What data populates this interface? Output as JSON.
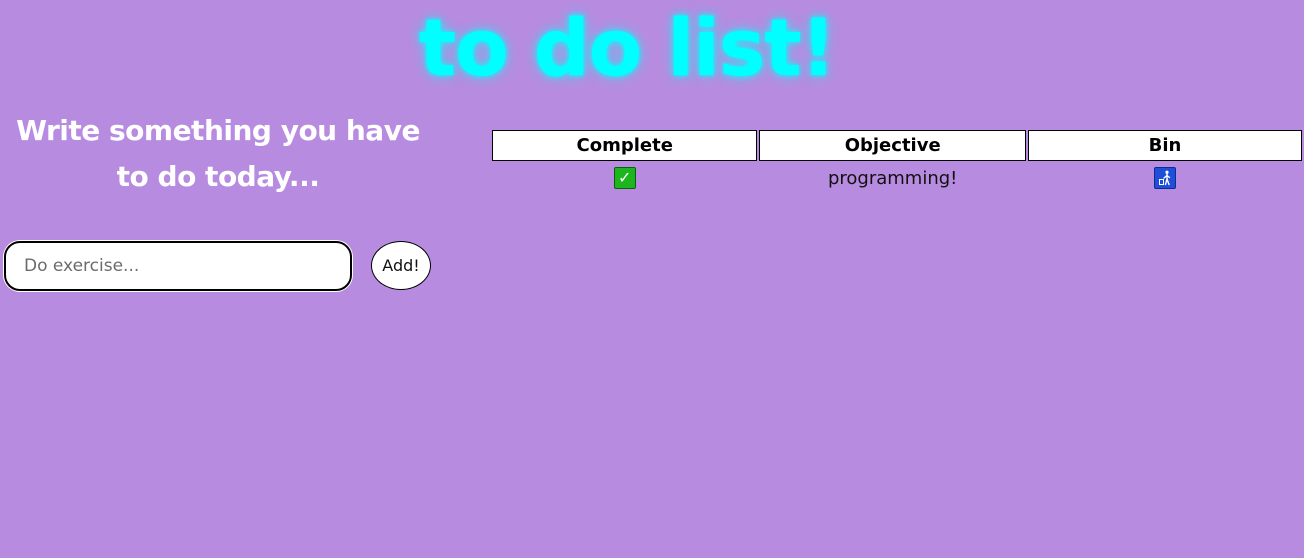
{
  "header": {
    "title": "to do list!"
  },
  "entry": {
    "prompt": "Write something you have to do today...",
    "input_placeholder": "Do exercise...",
    "input_value": "",
    "add_label": "Add!"
  },
  "table": {
    "columns": [
      "Complete",
      "Objective",
      "Bin"
    ],
    "rows": [
      {
        "complete_icon": "check-mark-icon",
        "objective": "programming!",
        "bin_icon": "trash-bin-icon"
      }
    ]
  },
  "colors": {
    "background": "#b78be0",
    "title": "#00ffff",
    "check": "#1db51d",
    "bin": "#1f4fd8"
  }
}
